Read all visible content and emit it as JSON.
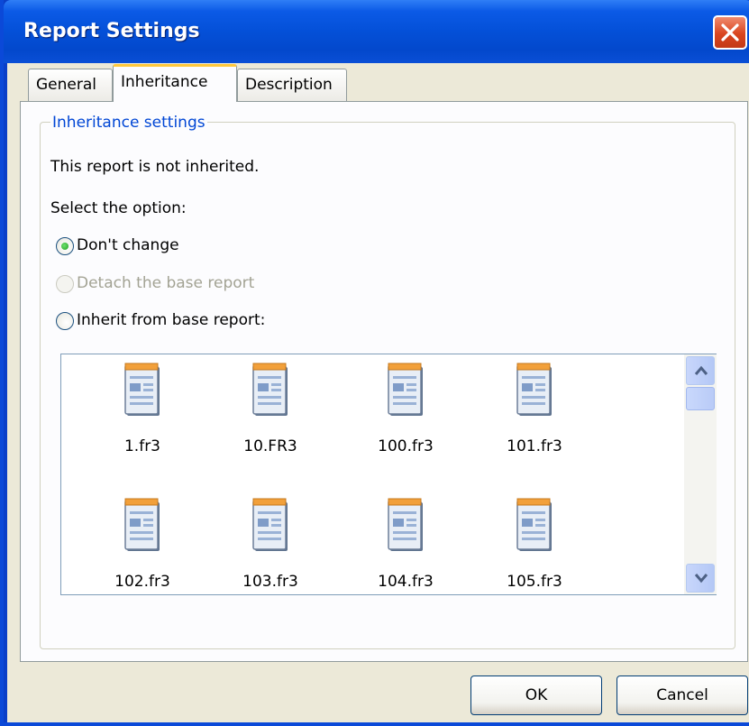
{
  "window": {
    "title": "Report Settings",
    "close_icon": "close-icon"
  },
  "tabs": [
    {
      "label": "General",
      "active": false
    },
    {
      "label": "Inheritance",
      "active": true
    },
    {
      "label": "Description",
      "active": false
    }
  ],
  "group": {
    "label": "Inheritance settings",
    "status_text": "This report is not inherited.",
    "prompt": "Select the option:"
  },
  "options": [
    {
      "label": "Don't change",
      "checked": true,
      "enabled": true
    },
    {
      "label": "Detach the base report",
      "checked": false,
      "enabled": false
    },
    {
      "label": "Inherit from base report:",
      "checked": false,
      "enabled": true
    }
  ],
  "files": [
    {
      "name": "1.fr3",
      "icon": "report-file-icon"
    },
    {
      "name": "10.FR3",
      "icon": "report-file-icon"
    },
    {
      "name": "100.fr3",
      "icon": "report-file-icon"
    },
    {
      "name": "101.fr3",
      "icon": "report-file-icon"
    },
    {
      "name": "102.fr3",
      "icon": "report-file-icon"
    },
    {
      "name": "103.fr3",
      "icon": "report-file-icon"
    },
    {
      "name": "104.fr3",
      "icon": "report-file-icon"
    },
    {
      "name": "105.fr3",
      "icon": "report-file-icon"
    }
  ],
  "buttons": {
    "ok_label": "OK",
    "cancel_label": "Cancel"
  },
  "colors": {
    "title_bar": "#0450d8",
    "group_label": "#0046d5",
    "active_tab_accent": "#ffc83c",
    "close_button": "#d9451f"
  }
}
